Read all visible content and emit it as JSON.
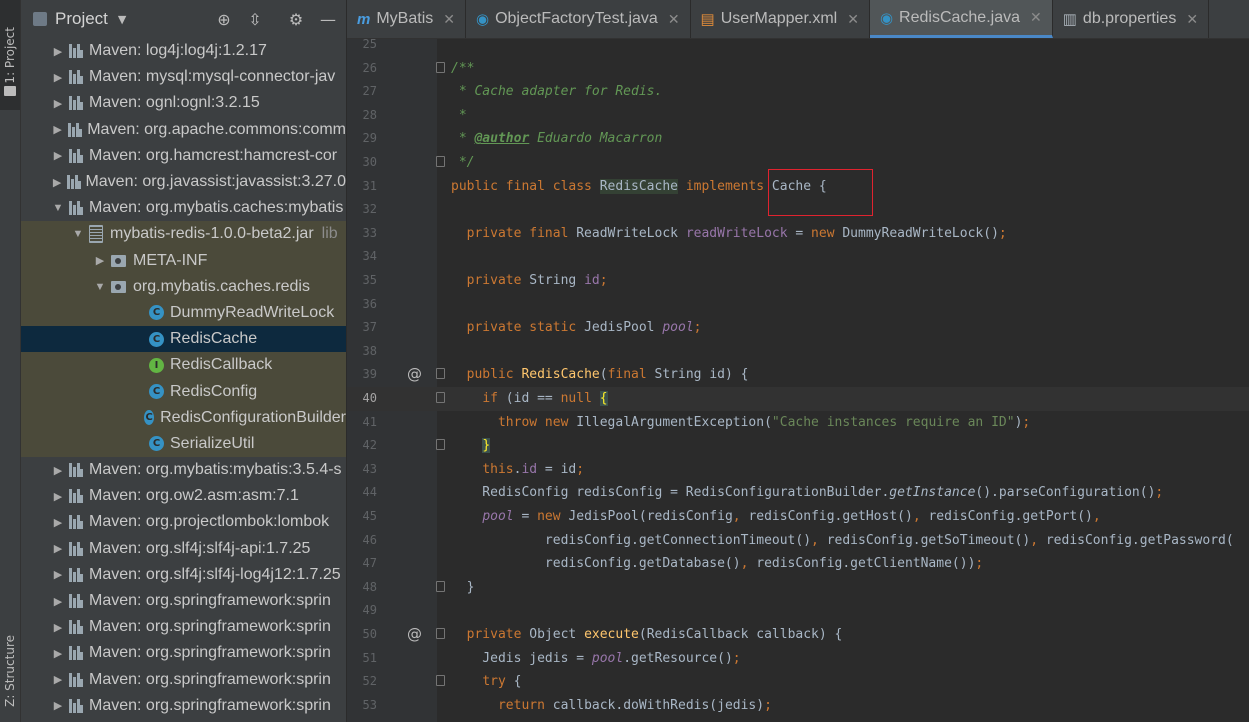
{
  "tool_strip": {
    "project_tab": "1: Project",
    "structure_tab": "Z: Structure"
  },
  "project_panel": {
    "title": "Project",
    "tree": [
      {
        "text": "Maven: log4j:log4j:1.2.17",
        "arrow": "▶",
        "icon": "library-icon",
        "indent": 0
      },
      {
        "text": "Maven: mysql:mysql-connector-jav",
        "arrow": "▶",
        "icon": "library-icon",
        "indent": 0
      },
      {
        "text": "Maven: ognl:ognl:3.2.15",
        "arrow": "▶",
        "icon": "library-icon",
        "indent": 0
      },
      {
        "text": "Maven: org.apache.commons:comm",
        "arrow": "▶",
        "icon": "library-icon",
        "indent": 0
      },
      {
        "text": "Maven: org.hamcrest:hamcrest-cor",
        "arrow": "▶",
        "icon": "library-icon",
        "indent": 0
      },
      {
        "text": "Maven: org.javassist:javassist:3.27.0",
        "arrow": "▶",
        "icon": "library-icon",
        "indent": 0
      },
      {
        "text": "Maven: org.mybatis.caches:mybatis",
        "arrow": "▼",
        "icon": "library-icon",
        "indent": 0
      },
      {
        "text": "mybatis-redis-1.0.0-beta2.jar",
        "suffix": "lib",
        "arrow": "▼",
        "icon": "jar-icon",
        "indent": 1,
        "scope": true
      },
      {
        "text": "META-INF",
        "arrow": "▶",
        "icon": "package-icon",
        "indent": 2,
        "scope": true
      },
      {
        "text": "org.mybatis.caches.redis",
        "arrow": "▼",
        "icon": "package-icon",
        "indent": 2,
        "scope": true
      },
      {
        "text": "DummyReadWriteLock",
        "arrow": "",
        "icon": "class-icon",
        "indent": 3,
        "scope": true
      },
      {
        "text": "RedisCache",
        "arrow": "",
        "icon": "class-icon",
        "indent": 3,
        "scope": true,
        "selected": true
      },
      {
        "text": "RedisCallback",
        "arrow": "",
        "icon": "interface-icon",
        "indent": 3,
        "scope": true
      },
      {
        "text": "RedisConfig",
        "arrow": "",
        "icon": "class-icon",
        "indent": 3,
        "scope": true
      },
      {
        "text": "RedisConfigurationBuilder",
        "arrow": "",
        "icon": "class-icon",
        "indent": 3,
        "scope": true
      },
      {
        "text": "SerializeUtil",
        "arrow": "",
        "icon": "class-icon",
        "indent": 3,
        "scope": true
      },
      {
        "text": "Maven: org.mybatis:mybatis:3.5.4-s",
        "arrow": "▶",
        "icon": "library-icon",
        "indent": 0
      },
      {
        "text": "Maven: org.ow2.asm:asm:7.1",
        "arrow": "▶",
        "icon": "library-icon",
        "indent": 0
      },
      {
        "text": "Maven: org.projectlombok:lombok",
        "arrow": "▶",
        "icon": "library-icon",
        "indent": 0
      },
      {
        "text": "Maven: org.slf4j:slf4j-api:1.7.25",
        "arrow": "▶",
        "icon": "library-icon",
        "indent": 0
      },
      {
        "text": "Maven: org.slf4j:slf4j-log4j12:1.7.25",
        "arrow": "▶",
        "icon": "library-icon",
        "indent": 0
      },
      {
        "text": "Maven: org.springframework:sprin",
        "arrow": "▶",
        "icon": "library-icon",
        "indent": 0
      },
      {
        "text": "Maven: org.springframework:sprin",
        "arrow": "▶",
        "icon": "library-icon",
        "indent": 0
      },
      {
        "text": "Maven: org.springframework:sprin",
        "arrow": "▶",
        "icon": "library-icon",
        "indent": 0
      },
      {
        "text": "Maven: org.springframework:sprin",
        "arrow": "▶",
        "icon": "library-icon",
        "indent": 0
      },
      {
        "text": "Maven: org.springframework:sprin",
        "arrow": "▶",
        "icon": "library-icon",
        "indent": 0
      }
    ]
  },
  "editor_tabs": [
    {
      "label": "MyBatis",
      "icon": "m",
      "active": false
    },
    {
      "label": "ObjectFactoryTest.java",
      "icon": "c",
      "active": false
    },
    {
      "label": "UserMapper.xml",
      "icon": "x",
      "active": false
    },
    {
      "label": "RedisCache.java",
      "icon": "c",
      "active": true
    },
    {
      "label": "db.properties",
      "icon": "p",
      "active": false
    }
  ],
  "code_lines": [
    {
      "n": "25",
      "seg": []
    },
    {
      "n": "26",
      "fold": true,
      "seg": [
        [
          "cm",
          "/**"
        ]
      ]
    },
    {
      "n": "27",
      "seg": [
        [
          "cm",
          " * Cache adapter for Redis."
        ]
      ]
    },
    {
      "n": "28",
      "seg": [
        [
          "cm",
          " *"
        ]
      ]
    },
    {
      "n": "29",
      "seg": [
        [
          "cm",
          " * "
        ],
        [
          "tag",
          "@author"
        ],
        [
          "cm",
          " Eduardo Macarron"
        ]
      ]
    },
    {
      "n": "30",
      "fold": true,
      "seg": [
        [
          "cm",
          " */"
        ]
      ]
    },
    {
      "n": "31",
      "seg": [
        [
          "kw",
          "public final class "
        ],
        [
          "cls-hl",
          "RedisCache"
        ],
        [
          "kw",
          " implements "
        ],
        [
          "",
          "Cache {"
        ]
      ]
    },
    {
      "n": "32",
      "seg": []
    },
    {
      "n": "33",
      "seg": [
        [
          "",
          "  "
        ],
        [
          "kw",
          "private final "
        ],
        [
          "",
          "ReadWriteLock "
        ],
        [
          "fld",
          "readWriteLock"
        ],
        [
          "",
          " = "
        ],
        [
          "kw",
          "new "
        ],
        [
          "",
          "DummyReadWriteLock()"
        ],
        [
          "kw",
          ";"
        ]
      ]
    },
    {
      "n": "34",
      "seg": []
    },
    {
      "n": "35",
      "seg": [
        [
          "",
          "  "
        ],
        [
          "kw",
          "private "
        ],
        [
          "",
          "String "
        ],
        [
          "fld",
          "id"
        ],
        [
          "kw",
          ";"
        ]
      ]
    },
    {
      "n": "36",
      "seg": []
    },
    {
      "n": "37",
      "seg": [
        [
          "",
          "  "
        ],
        [
          "kw",
          "private static "
        ],
        [
          "",
          "JedisPool "
        ],
        [
          "sfld",
          "pool"
        ],
        [
          "kw",
          ";"
        ]
      ]
    },
    {
      "n": "38",
      "seg": []
    },
    {
      "n": "39",
      "override": true,
      "fold": true,
      "seg": [
        [
          "",
          "  "
        ],
        [
          "kw",
          "public "
        ],
        [
          "meth",
          "RedisCache"
        ],
        [
          "",
          "("
        ],
        [
          "kw",
          "final "
        ],
        [
          "",
          "String id) {"
        ]
      ]
    },
    {
      "n": "40",
      "current": true,
      "fold": true,
      "seg": [
        [
          "",
          "    "
        ],
        [
          "kw",
          "if "
        ],
        [
          "",
          "(id == "
        ],
        [
          "kw",
          "null"
        ],
        [
          ")",
          " "
        ],
        [
          "brace-hl",
          "{"
        ]
      ]
    },
    {
      "n": "41",
      "seg": [
        [
          "",
          "      "
        ],
        [
          "kw",
          "throw new "
        ],
        [
          "",
          "IllegalArgumentException("
        ],
        [
          "str",
          "\"Cache instances require an ID\""
        ],
        [
          "",
          ")"
        ],
        [
          "kw",
          ";"
        ]
      ]
    },
    {
      "n": "42",
      "fold": true,
      "seg": [
        [
          "",
          "    "
        ],
        [
          "brace-hl",
          "}"
        ]
      ]
    },
    {
      "n": "43",
      "seg": [
        [
          "",
          "    "
        ],
        [
          "kw",
          "this"
        ],
        [
          "",
          "."
        ],
        [
          "fld",
          "id"
        ],
        [
          "",
          " = id"
        ],
        [
          "kw",
          ";"
        ]
      ]
    },
    {
      "n": "44",
      "seg": [
        [
          "",
          "    RedisConfig redisConfig = RedisConfigurationBuilder."
        ],
        [
          "smeth",
          "getInstance"
        ],
        [
          "",
          "().parseConfiguration()"
        ],
        [
          "kw",
          ";"
        ]
      ]
    },
    {
      "n": "45",
      "seg": [
        [
          "",
          "    "
        ],
        [
          "sfld",
          "pool"
        ],
        [
          "",
          " = "
        ],
        [
          "kw",
          "new "
        ],
        [
          "",
          "JedisPool(redisConfig"
        ],
        [
          "kw",
          ", "
        ],
        [
          "",
          "redisConfig.getHost()"
        ],
        [
          "kw",
          ", "
        ],
        [
          "",
          "redisConfig.getPort()"
        ],
        [
          "kw",
          ","
        ]
      ]
    },
    {
      "n": "46",
      "seg": [
        [
          "",
          "            redisConfig.getConnectionTimeout()"
        ],
        [
          "kw",
          ", "
        ],
        [
          "",
          "redisConfig.getSoTimeout()"
        ],
        [
          "kw",
          ", "
        ],
        [
          "",
          "redisConfig.getPassword("
        ]
      ]
    },
    {
      "n": "47",
      "seg": [
        [
          "",
          "            redisConfig.getDatabase()"
        ],
        [
          "kw",
          ", "
        ],
        [
          "",
          "redisConfig.getClientName())"
        ],
        [
          "kw",
          ";"
        ]
      ]
    },
    {
      "n": "48",
      "fold": true,
      "seg": [
        [
          "",
          "  }"
        ]
      ]
    },
    {
      "n": "49",
      "seg": []
    },
    {
      "n": "50",
      "override": true,
      "fold": true,
      "seg": [
        [
          "",
          "  "
        ],
        [
          "kw",
          "private "
        ],
        [
          "",
          "Object "
        ],
        [
          "meth",
          "execute"
        ],
        [
          "",
          "(RedisCallback callback) {"
        ]
      ]
    },
    {
      "n": "51",
      "seg": [
        [
          "",
          "    Jedis jedis = "
        ],
        [
          "sfld",
          "pool"
        ],
        [
          "",
          ".getResource()"
        ],
        [
          "kw",
          ";"
        ]
      ]
    },
    {
      "n": "52",
      "fold": true,
      "seg": [
        [
          "",
          "    "
        ],
        [
          "kw",
          "try "
        ],
        [
          "",
          "{"
        ]
      ]
    },
    {
      "n": "53",
      "seg": [
        [
          "",
          "      "
        ],
        [
          "kw",
          "return "
        ],
        [
          "",
          "callback.doWithRedis(jedis)"
        ],
        [
          "kw",
          ";"
        ]
      ]
    }
  ]
}
